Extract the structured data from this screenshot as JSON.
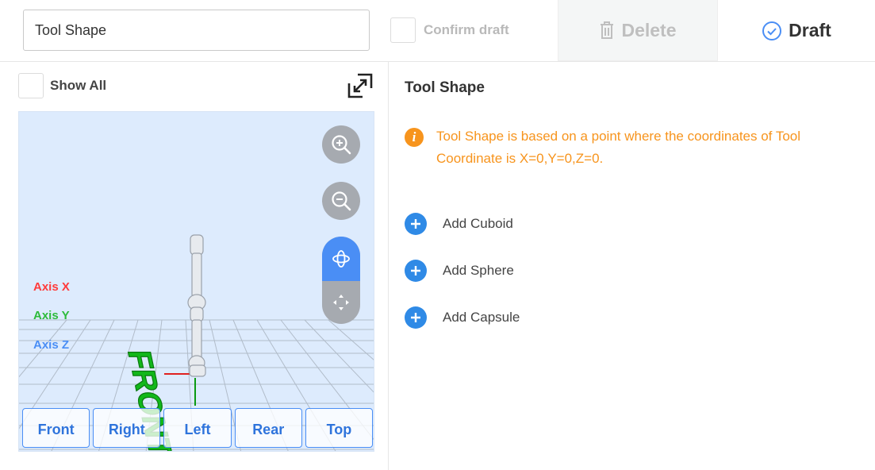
{
  "header": {
    "name_value": "Tool Shape",
    "confirm_label": "Confirm draft",
    "delete_label": "Delete",
    "draft_label": "Draft"
  },
  "viewer": {
    "show_all_label": "Show All",
    "axis_labels": {
      "x": "Axis X",
      "y": "Axis Y",
      "z": "Axis Z"
    },
    "axis_colors": {
      "x": "#ff3b3b",
      "y": "#2dbb3a",
      "z": "#4a8ef5"
    },
    "floor_text": "FRONT",
    "view_buttons": [
      "Front",
      "Right",
      "Left",
      "Rear",
      "Top"
    ],
    "icons": [
      "expand-icon",
      "zoom-in-icon",
      "zoom-out-icon",
      "rotate-icon",
      "pan-icon"
    ]
  },
  "panel": {
    "title": "Tool Shape",
    "info_text": "Tool Shape is based on a point where the coordinates of Tool Coordinate is X=0,Y=0,Z=0.",
    "add_items": [
      "Add Cuboid",
      "Add Sphere",
      "Add Capsule"
    ]
  },
  "colors": {
    "accent": "#4a8ef5",
    "warning": "#f7941d",
    "add_icon": "#2f8ae6"
  }
}
